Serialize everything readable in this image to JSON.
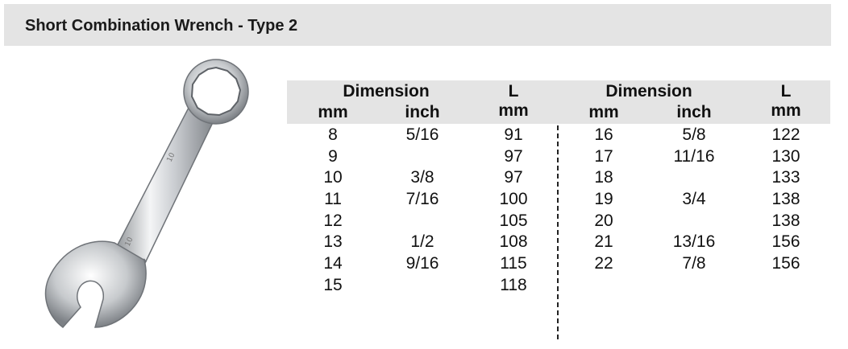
{
  "title": "Short Combination Wrench - Type 2",
  "table": {
    "left_header": {
      "group": "Dimension",
      "col1": "mm",
      "col2": "inch",
      "l_top": "L",
      "l_bottom": "mm"
    },
    "right_header": {
      "group": "Dimension",
      "col1": "mm",
      "col2": "inch",
      "l_top": "L",
      "l_bottom": "mm"
    },
    "left_rows": [
      [
        "8",
        "5/16",
        "91"
      ],
      [
        "9",
        "",
        "97"
      ],
      [
        "10",
        "3/8",
        "97"
      ],
      [
        "11",
        "7/16",
        "100"
      ],
      [
        "12",
        "",
        "105"
      ],
      [
        "13",
        "1/2",
        "108"
      ],
      [
        "14",
        "9/16",
        "115"
      ],
      [
        "15",
        "",
        "118"
      ]
    ],
    "right_rows": [
      [
        "16",
        "5/8",
        "122"
      ],
      [
        "17",
        "11/16",
        "130"
      ],
      [
        "18",
        "",
        "133"
      ],
      [
        "19",
        "3/4",
        "138"
      ],
      [
        "20",
        "",
        "138"
      ],
      [
        "21",
        "13/16",
        "156"
      ],
      [
        "22",
        "7/8",
        "156"
      ]
    ]
  },
  "colors": {
    "header_band": "#e4e4e4",
    "text": "#111111"
  },
  "image": {
    "icon": "combination-wrench-icon"
  }
}
